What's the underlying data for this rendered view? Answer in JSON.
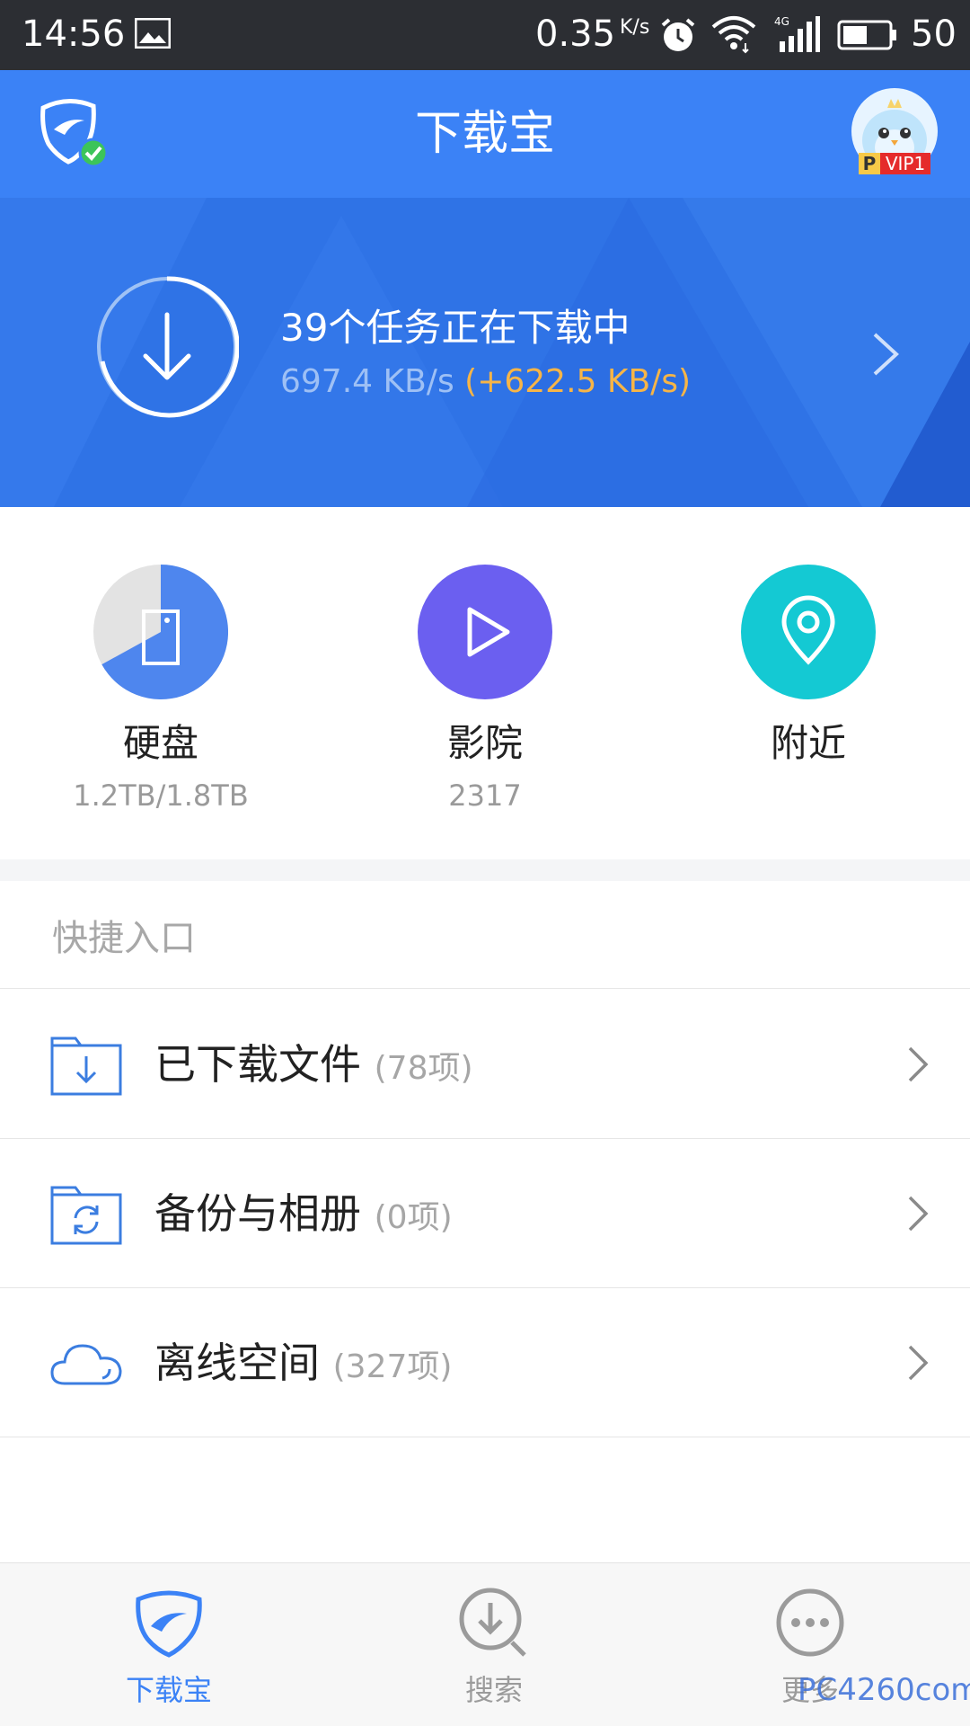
{
  "status_bar": {
    "time": "14:56",
    "net_speed": "0.35",
    "net_speed_unit": "K/s",
    "battery": "50",
    "icons": [
      "image-icon",
      "alarm-icon",
      "wifi-icon",
      "signal-4g-icon",
      "battery-icon"
    ]
  },
  "header": {
    "title": "下载宝",
    "vip_p": "P",
    "vip_label": "VIP1"
  },
  "banner": {
    "title": "39个任务正在下载中",
    "speed": "697.4 KB/s",
    "speed_extra": "(+622.5 KB/s)"
  },
  "features": [
    {
      "label": "硬盘",
      "sub": "1.2TB/1.8TB",
      "icon": "disk-icon",
      "color": "#4e86ee",
      "used_fraction": 0.67
    },
    {
      "label": "影院",
      "sub": "2317",
      "icon": "play-icon",
      "color": "#6b5ff0"
    },
    {
      "label": "附近",
      "sub": "",
      "icon": "location-icon",
      "color": "#14c9d3"
    }
  ],
  "quick": {
    "title": "快捷入口",
    "items": [
      {
        "label": "已下载文件",
        "count": "(78项)",
        "icon": "download-folder-icon"
      },
      {
        "label": "备份与相册",
        "count": "(0项)",
        "icon": "backup-folder-icon"
      },
      {
        "label": "离线空间",
        "count": "(327项)",
        "icon": "cloud-icon"
      }
    ]
  },
  "bottom_nav": {
    "items": [
      {
        "label": "下载宝",
        "icon": "shield-icon",
        "active": true
      },
      {
        "label": "搜索",
        "icon": "search-download-icon",
        "active": false
      },
      {
        "label": "更多",
        "icon": "more-icon",
        "active": false
      }
    ]
  },
  "watermark": "PC4260com",
  "colors": {
    "header": "#3b82f6",
    "banner": "#2f73e6",
    "accent_orange": "#f7b547",
    "line_icon": "#3b7de0"
  }
}
